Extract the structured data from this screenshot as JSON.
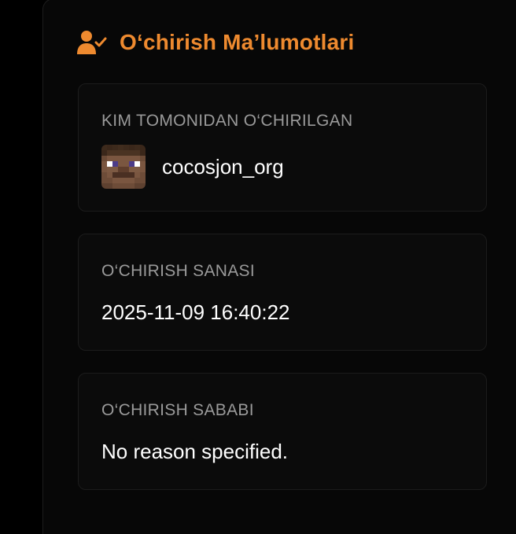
{
  "section": {
    "title": "O‘chirish Ma’lumotlari",
    "icon": "user-check-icon",
    "accent_color": "#ee8a2f"
  },
  "deleted_by": {
    "label": "KIM TOMONIDAN O‘CHIRILGAN",
    "username": "cocosjon_org",
    "avatar_icon": "minecraft-player-head"
  },
  "deletion_date": {
    "label": "O‘CHIRISH SANASI",
    "value": "2025-11-09 16:40:22"
  },
  "deletion_reason": {
    "label": "O‘CHIRISH SABABI",
    "value": "No reason specified."
  }
}
